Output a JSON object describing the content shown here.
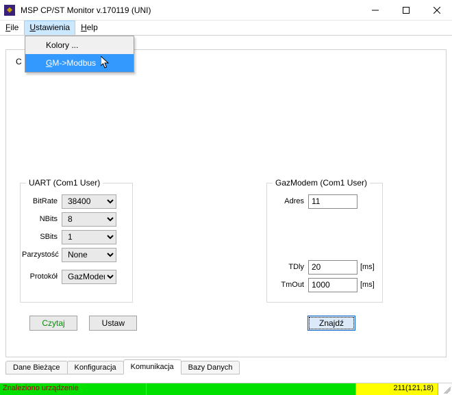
{
  "window": {
    "title": "MSP CP/ST Monitor v.170119 (UNI)"
  },
  "menubar": {
    "file": "File",
    "file_u": "F",
    "settings": "Ustawienia",
    "settings_u": "U",
    "help": "Help",
    "help_u": "H"
  },
  "dropdown": {
    "kolory": "Kolory ...",
    "gm_modbus": "GM->Modbus",
    "gm_modbus_u": "G"
  },
  "panel": {
    "partial_label": "C"
  },
  "uart": {
    "legend": "UART (Com1 User)",
    "bitrate_label": "BitRate",
    "bitrate_value": "38400",
    "nbits_label": "NBits",
    "nbits_value": "8",
    "sbits_label": "SBits",
    "sbits_value": "1",
    "parity_label": "Parzystość",
    "parity_value": "None",
    "protocol_label": "Protokół",
    "protocol_value": "GazModem",
    "btn_czytaj": "Czytaj",
    "btn_ustaw": "Ustaw"
  },
  "gaz": {
    "legend": "GazModem (Com1 User)",
    "adres_label": "Adres",
    "adres_value": "11",
    "tdly_label": "TDly",
    "tdly_value": "20",
    "tmout_label": "TmOut",
    "tmout_value": "1000",
    "unit_ms": "[ms]",
    "btn_znajdz": "Znajdź"
  },
  "tabs": {
    "dane": "Dane Bieżące",
    "konf": "Konfiguracja",
    "komu": "Komunikacja",
    "bazy": "Bazy Danych"
  },
  "status": {
    "found": "Znaleziono urządzenie",
    "coords": "211(121,18)"
  }
}
